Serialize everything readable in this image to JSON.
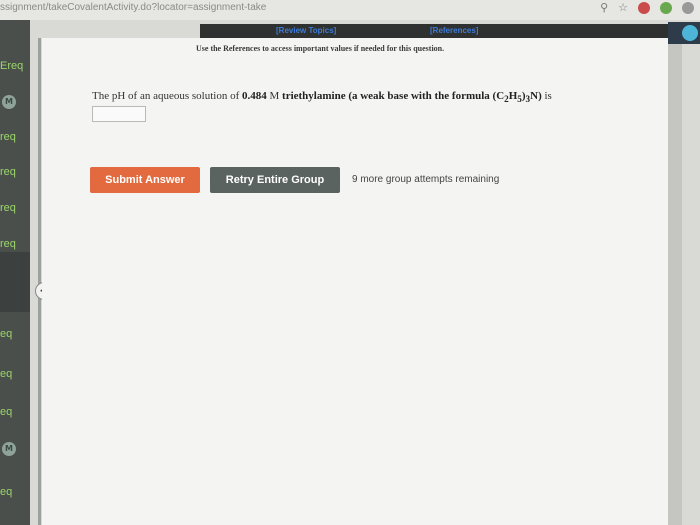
{
  "browser": {
    "url": "ssignment/takeCovalentActivity.do?locator=assignment-take"
  },
  "sidebar": {
    "items": [
      {
        "label": "Ereq",
        "badge": ""
      },
      {
        "label": "",
        "badge": "M"
      },
      {
        "label": "req",
        "badge": ""
      },
      {
        "label": "req",
        "badge": ""
      },
      {
        "label": "req",
        "badge": ""
      },
      {
        "label": "req",
        "badge": ""
      },
      {
        "label": "eq",
        "badge": ""
      },
      {
        "label": "eq",
        "badge": ""
      },
      {
        "label": "eq",
        "badge": ""
      },
      {
        "label": "",
        "badge": "M"
      },
      {
        "label": "eq",
        "badge": ""
      }
    ],
    "collapse_glyph": "<"
  },
  "header": {
    "review_topics": "[Review Topics]",
    "references": "[References]"
  },
  "instructions": "Use the References to access important values if needed for this question.",
  "question": {
    "prefix": "The pH of an aqueous solution of ",
    "concentration": "0.484",
    "unit": " M ",
    "compound": "triethylamine (a weak base with the formula (C",
    "sub1": "2",
    "h": "H",
    "sub2": "5",
    "close": ")",
    "sub3": "3",
    "end": "N)",
    "suffix": " is",
    "answer_value": ""
  },
  "actions": {
    "submit_label": "Submit Answer",
    "retry_label": "Retry Entire Group",
    "attempts_text": "9 more group attempts remaining"
  },
  "colors": {
    "submit": "#e36a3f",
    "retry": "#5b6361",
    "sidebar_text": "#9bd66a",
    "link": "#3d7bd6"
  }
}
